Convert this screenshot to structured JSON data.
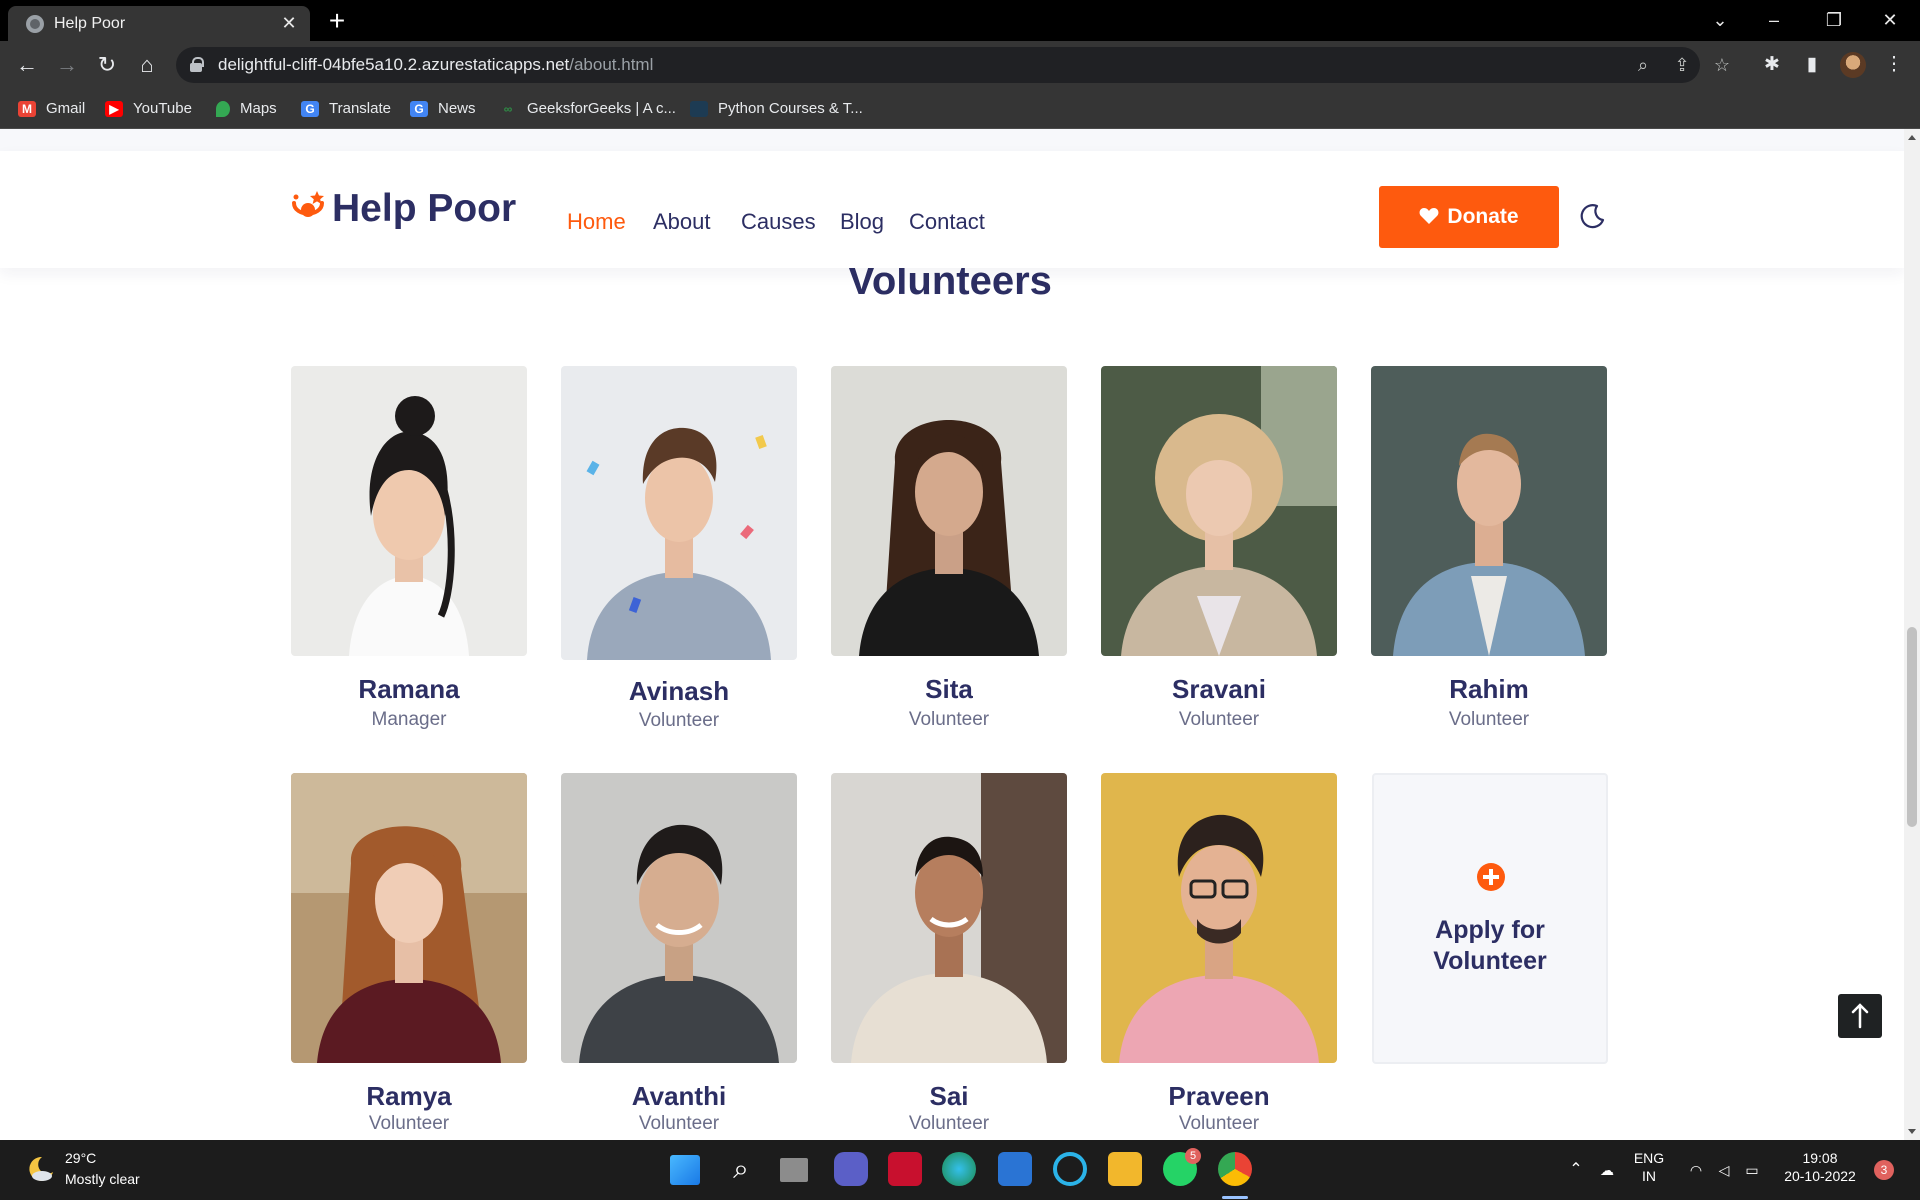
{
  "browser": {
    "tab_title": "Help Poor",
    "url_host": "delightful-cliff-04bfe5a10.2.azurestaticapps.net",
    "url_path": "/about.html",
    "bookmarks": [
      {
        "label": "Gmail",
        "icon": "gmail-icon",
        "color": "#ea4335"
      },
      {
        "label": "YouTube",
        "icon": "youtube-icon",
        "color": "#ff0000"
      },
      {
        "label": "Maps",
        "icon": "maps-icon",
        "color": "#34a853"
      },
      {
        "label": "Translate",
        "icon": "translate-icon",
        "color": "#4285f4"
      },
      {
        "label": "News",
        "icon": "news-icon",
        "color": "#4285f4"
      },
      {
        "label": "GeeksforGeeks | A c...",
        "icon": "geeksforgeeks-icon",
        "color": "#2f8d46"
      },
      {
        "label": "Python Courses & T...",
        "icon": "python-courses-icon",
        "color": "#1d3b53"
      }
    ]
  },
  "site": {
    "logo_text": "Help Poor",
    "brand_color": "#fe5a0e",
    "text_color": "#2c2e63",
    "nav": [
      "Home",
      "About",
      "Causes",
      "Blog",
      "Contact"
    ],
    "active_nav": "Home",
    "donate_label": "Donate"
  },
  "volunteers": {
    "title": "Volunteers",
    "members": [
      {
        "name": "Ramana",
        "role": "Manager"
      },
      {
        "name": "Avinash",
        "role": "Volunteer"
      },
      {
        "name": "Sita",
        "role": "Volunteer"
      },
      {
        "name": "Sravani",
        "role": "Volunteer"
      },
      {
        "name": "Rahim",
        "role": "Volunteer"
      },
      {
        "name": "Ramya",
        "role": "Volunteer"
      },
      {
        "name": "Avanthi",
        "role": "Volunteer"
      },
      {
        "name": "Sai",
        "role": "Volunteer"
      },
      {
        "name": "Praveen",
        "role": "Volunteer"
      }
    ],
    "apply_label_line1": "Apply for",
    "apply_label_line2": "Volunteer"
  },
  "taskbar": {
    "temperature": "29°C",
    "weather": "Mostly clear",
    "language": "ENG",
    "region": "IN",
    "time": "19:08",
    "date": "20-10-2022",
    "whatsapp_badge": "5",
    "notification_count": "3"
  }
}
